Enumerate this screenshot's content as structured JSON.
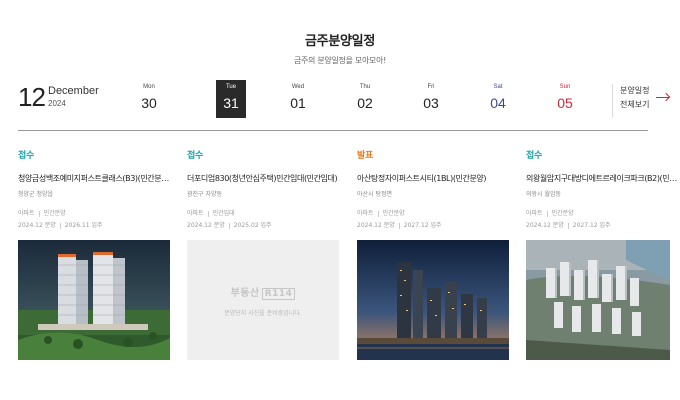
{
  "header": {
    "title": "금주분양일정",
    "subtitle": "금주의 분양일정을 모아모아!"
  },
  "current_date": {
    "day": "12",
    "month": "December",
    "year": "2024"
  },
  "days": [
    {
      "name": "Mon",
      "num": "30",
      "state": "normal"
    },
    {
      "name": "Tue",
      "num": "31",
      "state": "active"
    },
    {
      "name": "Wed",
      "num": "01",
      "state": "normal"
    },
    {
      "name": "Thu",
      "num": "02",
      "state": "normal"
    },
    {
      "name": "Fri",
      "num": "03",
      "state": "normal"
    },
    {
      "name": "Sat",
      "num": "04",
      "state": "sat"
    },
    {
      "name": "Sun",
      "num": "05",
      "state": "sun"
    }
  ],
  "view_all": {
    "line1": "분양일정",
    "line2": "전체보기"
  },
  "cards": [
    {
      "status": "접수",
      "status_color": "#1aa3a7",
      "name": "청양금성백조예미지퍼스트클래스(B3)(민간분양)",
      "location": "청양군 청양읍",
      "type": "아파트",
      "sale_type": "민간분양",
      "sale_date": "2024.12 분양",
      "move_in": "2026.11 입주"
    },
    {
      "status": "접수",
      "status_color": "#1aa3a7",
      "name": "더포디엄830(청년안심주택)민간임대(민간임대)",
      "location": "광진구 자양동",
      "type": "아파트",
      "sale_type": "민간임대",
      "sale_date": "2024.12 분양",
      "move_in": "2025.02 입주",
      "placeholder_logo": "부동산",
      "placeholder_logo_box": "R114",
      "placeholder_text": "분양단지 사진을 준비중입니다."
    },
    {
      "status": "발표",
      "status_color": "#e8761c",
      "name": "아산탕정자이퍼스트시티(1BL)(민간분양)",
      "location": "아산시 탕정면",
      "type": "아파트",
      "sale_type": "민간분양",
      "sale_date": "2024.12 분양",
      "move_in": "2027.12 입주"
    },
    {
      "status": "접수",
      "status_color": "#1aa3a7",
      "name": "의왕월암지구대방디에트르레이크파크(B2)(민간분양)",
      "location": "의왕시 월암동",
      "type": "아파트",
      "sale_type": "민간분양",
      "sale_date": "2024.12 분양",
      "move_in": "2027.12 입주"
    }
  ]
}
